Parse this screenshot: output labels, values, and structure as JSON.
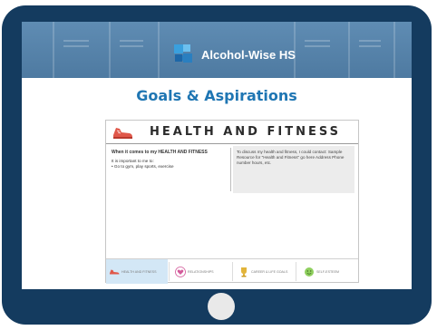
{
  "app": {
    "brand_title": "Alcohol-Wise HS",
    "page_title": "Goals & Aspirations"
  },
  "document": {
    "heading": "HEALTH AND FITNESS",
    "question": "When it comes to my HEALTH AND FITNESS",
    "important_label": "It is important to me to:",
    "bullet": "• Go to gym, play sports, exercise",
    "contact_text": "To discuss my health and fitness, I could contact: Sample Resource for \"Health and Fitness\" go here Address Phone number hours, etc."
  },
  "tabs": [
    {
      "label": "HEALTH AND FITNESS",
      "icon": "shoe-icon",
      "active": true
    },
    {
      "label": "RELATIONSHIPS",
      "icon": "heart-icon",
      "active": false
    },
    {
      "label": "CAREER & LIFE GOALS",
      "icon": "trophy-icon",
      "active": false
    },
    {
      "label": "SELF-ESTEEM",
      "icon": "smiley-icon",
      "active": false
    }
  ],
  "colors": {
    "tablet": "#143b5f",
    "banner": "#5883aa",
    "title": "#1f76b3",
    "shoe": "#e0584a",
    "active_tab": "#d3e7f6"
  }
}
